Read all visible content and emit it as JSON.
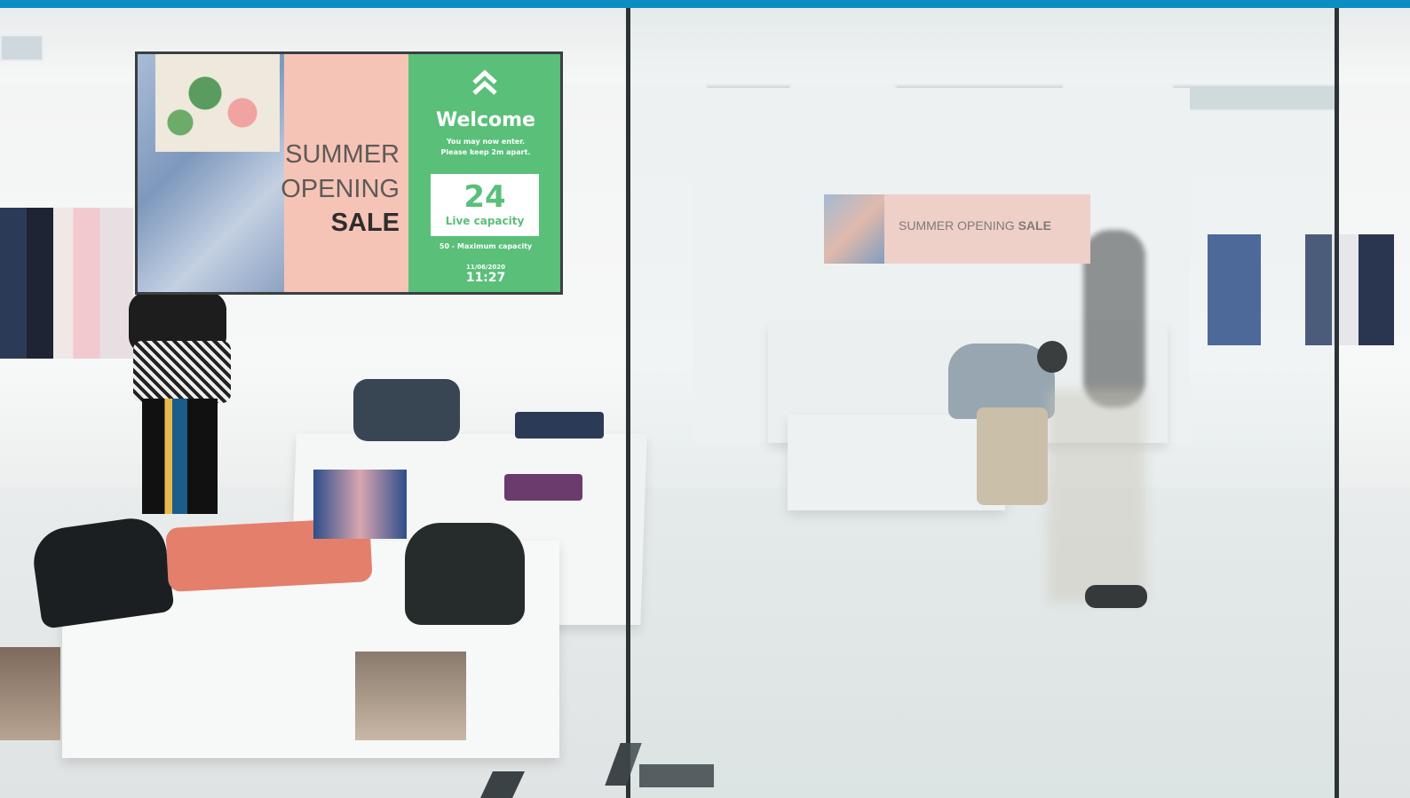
{
  "signage": {
    "headline_line1": "SUMMER",
    "headline_line2": "OPENING",
    "headline_line3": "SALE",
    "welcome": "Welcome",
    "instruction_line1": "You may now enter.",
    "instruction_line2": "Please keep 2m apart.",
    "live_count": "24",
    "live_label": "Live capacity",
    "max_text": "50 - Maximum capacity",
    "date": "11/06/2020",
    "time": "11:27",
    "accent_color": "#5abf79",
    "panel_color": "#f6c4b7",
    "logo_icon": "double-chevron-up-icon"
  },
  "back_banner": {
    "text_regular": "SUMMER OPENING ",
    "text_bold": "SALE"
  },
  "colors": {
    "top_bar": "#0b8fc2"
  }
}
